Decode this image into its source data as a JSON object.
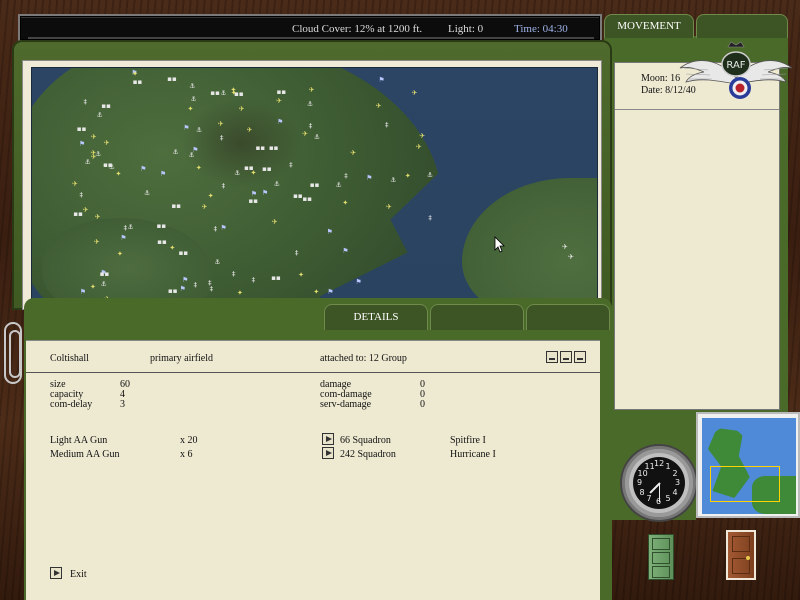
{
  "status_bar": {
    "cloud_cover": "Cloud Cover: 12% at 1200 ft.",
    "light": "Light:  0",
    "time": "Time: 04:30"
  },
  "tabs": {
    "movement": "MOVEMENT",
    "details": "DETAILS"
  },
  "side_panel": {
    "moon": "Moon:  16",
    "date": "Date:  8/12/40"
  },
  "logo": {
    "text": "RAF"
  },
  "details": {
    "header": {
      "name": "Coltishall",
      "type": "primary airfield",
      "attached": "attached to:  12 Group"
    },
    "stats_left": [
      {
        "label": "size",
        "value": "60"
      },
      {
        "label": "capacity",
        "value": "4"
      },
      {
        "label": "com-delay",
        "value": "3"
      }
    ],
    "stats_right": [
      {
        "label": "damage",
        "value": "0"
      },
      {
        "label": "com-damage",
        "value": "0"
      },
      {
        "label": "serv-damage",
        "value": "0"
      }
    ],
    "guns": [
      {
        "name": "Light AA Gun",
        "count": "x 20"
      },
      {
        "name": "Medium AA Gun",
        "count": "x 6"
      }
    ],
    "squadrons": [
      {
        "name": "66 Squadron",
        "aircraft": "Spitfire I"
      },
      {
        "name": "242 Squadron",
        "aircraft": "Hurricane I"
      }
    ],
    "exit_label": "Exit"
  },
  "clock": {
    "numerals": [
      "12",
      "1",
      "2",
      "3",
      "4",
      "5",
      "6",
      "7",
      "8",
      "9",
      "10",
      "11"
    ]
  },
  "colors": {
    "board_green": "#4a6a2a",
    "paper": "#eeead2",
    "sea": "#2c4565",
    "land": "#3e5c33",
    "time_text": "#9fb3e8"
  }
}
